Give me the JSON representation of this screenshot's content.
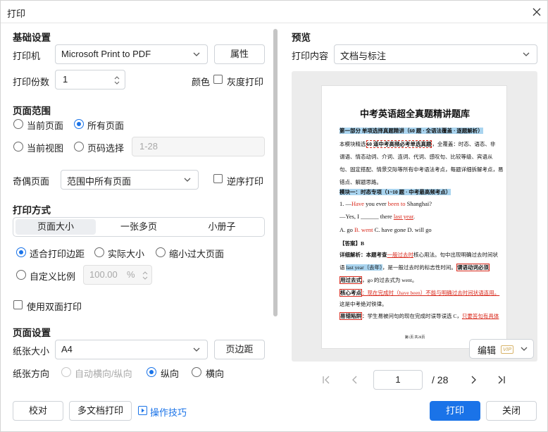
{
  "window": {
    "title": "打印"
  },
  "left": {
    "basic_title": "基础设置",
    "printer_label": "打印机",
    "printer_value": "Microsoft Print to PDF",
    "properties_btn": "属性",
    "copies_label": "打印份数",
    "copies_value": "1",
    "color_label": "颜色",
    "gray_label": "灰度打印",
    "range_title": "页面范围",
    "current_page": "当前页面",
    "all_pages": "所有页面",
    "current_view": "当前视图",
    "page_select": "页码选择",
    "page_select_placeholder": "1-28",
    "odd_even_label": "奇偶页面",
    "odd_even_value": "范围中所有页面",
    "reverse_label": "逆序打印",
    "mode_title": "打印方式",
    "mode_tabs": [
      "页面大小",
      "一张多页",
      "小册子"
    ],
    "mode_selected": "页面大小",
    "fit_margin": "适合打印边距",
    "actual_size": "实际大小",
    "shrink_large": "缩小过大页面",
    "custom_scale": "自定义比例",
    "scale_value": "100.00",
    "scale_unit": "%",
    "duplex_label": "使用双面打印",
    "page_setup_title": "页面设置",
    "paper_size_label": "纸张大小",
    "paper_size_value": "A4",
    "margins_btn": "页边距",
    "orientation_label": "纸张方向",
    "orient_auto": "自动横向/纵向",
    "orient_portrait": "纵向",
    "orient_landscape": "横向"
  },
  "right": {
    "preview_title": "预览",
    "content_label": "打印内容",
    "content_value": "文档与标注",
    "edit_btn": "编辑",
    "vip_badge": "VIP",
    "page_current": "1",
    "page_total": "/ 28"
  },
  "doc": {
    "title": "中考英语超全真题精讲题库",
    "l1": "第一部分 单项选择真题精讲（60 题 · 全语法覆盖 · 逐题解析）",
    "l2a": "本模块精选",
    "l2b": "60 道中考高频必考单选真题",
    "l2c": "，全覆盖：时态、语态、非",
    "l3": "谓语、情态动词、介词、连词、代词、感叹句、比较等级、宾语从",
    "l4": "句、固定搭配、情景交际等所有中考语法考点，每题详细拆解考点，易",
    "l5": "错点、解题思路。",
    "l6": "模块一：时态专项（1~10 题 · 中考最高频考点）",
    "l7a": "1. —",
    "l7b": "Have",
    "l7c": " you ever ",
    "l7d": "been to",
    "l7e": " Shanghai?",
    "l8a": "—Yes, I ______ there ",
    "l8b": "last year",
    ".": ".",
    "l8c": ".",
    "l9a": "A. go ",
    "l9b": "B. went",
    "l9c": " C. have gone D. will go",
    "l10": "【答案】B",
    "l11a": "详细解析：本题考查",
    "l11b": "一般过去时",
    "l11c": "核心用法。句中出现明确过去时间状",
    "l12a": "语 ",
    "l12b": "last year（去年）",
    "l12c": "，是一般过去时的标志性时间。",
    "l12d": "谓语动词必须",
    "l13a": "用过去式",
    "l13b": "，go 的过去式为 went。",
    "l14a": "核心考点",
    "l14b": "：现在完成时（have been）不能与明确过去时间状语连用。",
    "l15": "这是中考绝对铁律。",
    "l16a": "易错陷阱",
    "l16b": "：学生易被问句的现在完成时误导误选 C，",
    "l16c": "只要答句有具体",
    "footer": "第1页 共28页"
  },
  "footer": {
    "proofread": "校对",
    "multi_print": "多文档打印",
    "tips": "操作技巧",
    "print": "打印",
    "close": "关闭"
  },
  "colors": {
    "accent": "#1a73e8",
    "highlight": "#a9d4ef",
    "red": "#d9291c"
  }
}
